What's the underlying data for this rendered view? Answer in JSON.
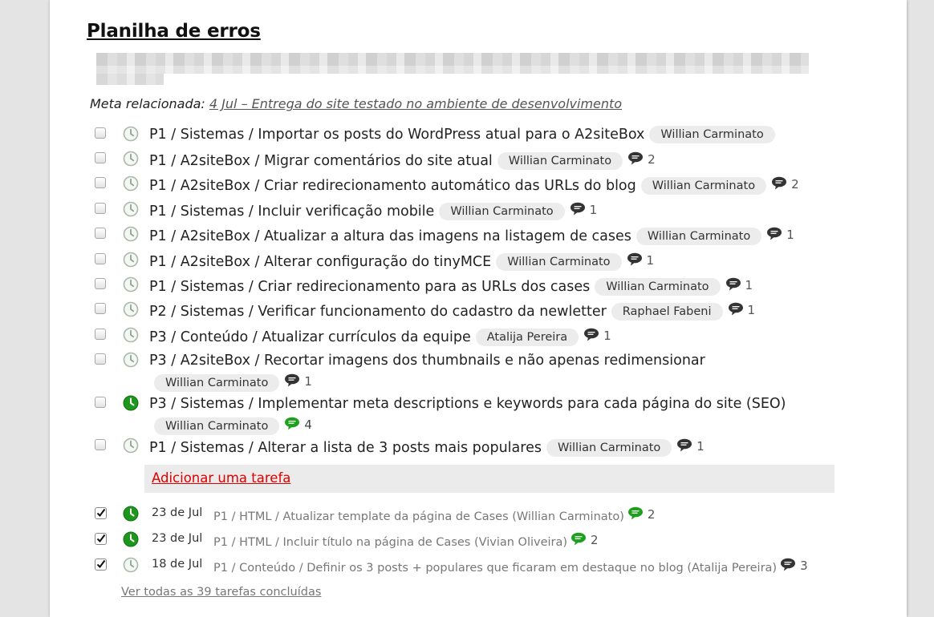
{
  "title": "Planilha de erros",
  "meta": {
    "label": "Meta relacionada:",
    "link": "4 Jul – Entrega do site testado no ambiente de desenvolvimento"
  },
  "tasks": [
    {
      "text": "P1 / Sistemas / Importar os posts do WordPress atual para o A2siteBox",
      "assignee": "Willian Carminato",
      "comments": "",
      "clock": "gray"
    },
    {
      "text": "P1 / A2siteBox / Migrar comentários do site atual",
      "assignee": "Willian Carminato",
      "comments": "2",
      "clock": "gray"
    },
    {
      "text": "P1 / A2siteBox / Criar redirecionamento automático das URLs do blog",
      "assignee": "Willian Carminato",
      "comments": "2",
      "clock": "gray"
    },
    {
      "text": "P1 / Sistemas / Incluir verificação mobile",
      "assignee": "Willian Carminato",
      "comments": "1",
      "clock": "gray"
    },
    {
      "text": "P1 / A2siteBox / Atualizar a altura das imagens na listagem de cases",
      "assignee": "Willian Carminato",
      "comments": "1",
      "clock": "gray"
    },
    {
      "text": "P1 / A2siteBox / Alterar configuração do tinyMCE",
      "assignee": "Willian Carminato",
      "comments": "1",
      "clock": "gray"
    },
    {
      "text": "P1 / Sistemas / Criar redirecionamento para as URLs dos cases",
      "assignee": "Willian Carminato",
      "comments": "1",
      "clock": "gray"
    },
    {
      "text": "P2 / Sistemas / Verificar funcionamento do cadastro da newletter",
      "assignee": "Raphael Fabeni",
      "comments": "1",
      "clock": "gray"
    },
    {
      "text": "P3 / Conteúdo / Atualizar currículos da equipe",
      "assignee": "Atalija Pereira",
      "comments": "1",
      "clock": "gray"
    },
    {
      "text": "P3 / A2siteBox / Recortar imagens dos thumbnails e não apenas redimensionar",
      "assignee": "Willian Carminato",
      "comments": "1",
      "clock": "gray"
    },
    {
      "text": "P3 / Sistemas / Implementar meta descriptions e keywords para cada página do site (SEO)",
      "assignee": "Willian Carminato",
      "comments": "4",
      "clock": "green",
      "comment_color": "green"
    },
    {
      "text": "P1 / Sistemas / Alterar a lista de 3 posts mais populares",
      "assignee": "Willian Carminato",
      "comments": "1",
      "clock": "gray"
    }
  ],
  "add_task_label": "Adicionar uma tarefa",
  "completed": [
    {
      "date": "23 de Jul",
      "text": "P1 / HTML / Atualizar template da página de Cases (Willian Carminato)",
      "comments": "2",
      "clock": "green",
      "comment_color": "green"
    },
    {
      "date": "23 de Jul",
      "text": "P1 / HTML / Incluir título na página de Cases (Vivian Oliveira)",
      "comments": "2",
      "clock": "green",
      "comment_color": "green"
    },
    {
      "date": "18 de Jul",
      "text": "P1 / Conteúdo / Definir os 3 posts + populares que ficaram em destaque no blog (Atalija Pereira)",
      "comments": "3",
      "clock": "gray",
      "comment_color": "gray"
    }
  ],
  "view_all_label": "Ver todas as 39 tarefas concluídas",
  "colors": {
    "accent_green": "#1ea01e",
    "add_link_red": "#e00000",
    "clock_gray": "#9aa89a"
  }
}
